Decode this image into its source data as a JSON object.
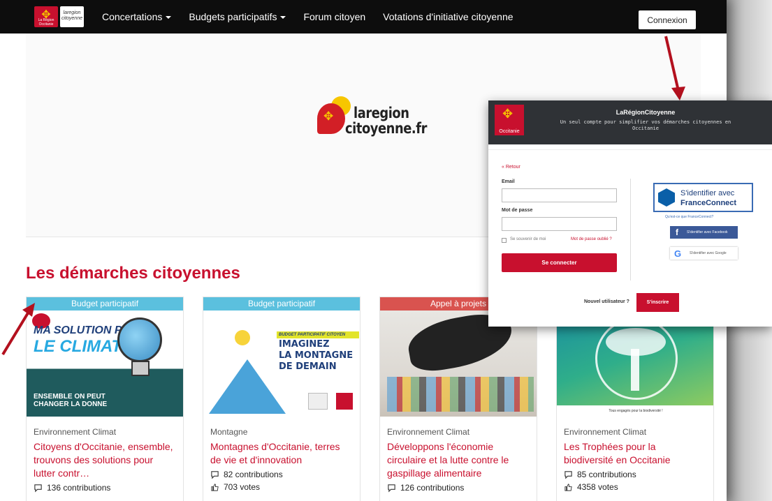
{
  "navbar": {
    "logo_occ_text": "La Région Occitanie",
    "logo_lrc_text": "laregion citoyenne",
    "items": [
      {
        "label": "Concertations",
        "dropdown": true
      },
      {
        "label": "Budgets participatifs",
        "dropdown": true
      },
      {
        "label": "Forum citoyen",
        "dropdown": false
      },
      {
        "label": "Votations d'initiative citoyenne",
        "dropdown": false
      }
    ],
    "login_label": "Connexion"
  },
  "hero": {
    "logo_line1": "laregion",
    "logo_line2": "citoyenne.fr"
  },
  "section_title": "Les démarches citoyennes",
  "cards": [
    {
      "tag": "Budget participatif",
      "tag_color": "#5bc0de",
      "image_alt": "MA SOLUTION POUR LE CLIMAT !",
      "image_headline1": "MA SOLUTION POUR",
      "image_headline2": "LE CLIMAT !",
      "image_bottom": "ENSEMBLE ON PEUT CHANGER LA DONNE",
      "category": "Environnement Climat",
      "title": "Citoyens d'Occitanie, ensemble, trouvons des solutions pour lutter contr…",
      "contributions": "136 contributions",
      "votes": ""
    },
    {
      "tag": "Budget participatif",
      "tag_color": "#5bc0de",
      "image_headline0": "BUDGET PARTICIPATIF CITOYEN",
      "image_headline1": "IMAGINEZ",
      "image_headline2": "LA MONTAGNE",
      "image_headline3": "DE DEMAIN",
      "category": "Montagne",
      "title": "Montagnes d'Occitanie, terres de vie et d'innovation",
      "contributions": "82 contributions",
      "votes": "703 votes"
    },
    {
      "tag": "Appel à projets",
      "tag_color": "#d9534f",
      "category": "Environnement Climat",
      "title": "Développons l'économie circulaire et la lutte contre le gaspillage alimentaire",
      "contributions": "126 contributions",
      "votes": ""
    },
    {
      "tag": "",
      "tag_color": "#5bc0de",
      "image_caption": "Tous engagés pour la biodiversité !",
      "category": "Environnement Climat",
      "title": "Les Trophées pour la biodiversité en Occitanie",
      "contributions": "85 contributions",
      "votes": "4358 votes"
    }
  ],
  "modal": {
    "brand": "LaRégionCitoyenne",
    "tagline": "Un seul compte pour simplifier vos démarches citoyennes en Occitanie",
    "occ_text": "Occitanie",
    "back": "« Retour",
    "email_label": "Email",
    "email_value": "",
    "password_label": "Mot de passe",
    "password_value": "",
    "remember": "Se souvenir de moi",
    "forgot": "Mot de passe oublié ?",
    "submit": "Se connecter",
    "fc_line1": "S'identifier avec",
    "fc_line2": "FranceConnect",
    "fc_what": "Qu'est-ce que FranceConnect?",
    "facebook": "S'identifier avec Facebook",
    "google": "S'identifier avec Google",
    "new_user": "Nouvel utilisateur ?",
    "signup": "S'inscrire"
  },
  "colors": {
    "brand_red": "#c8102e",
    "nav_bg": "#0d0d0d",
    "tag_blue": "#5bc0de",
    "tag_red": "#d9534f",
    "annotation_arrow": "#b3101e"
  }
}
